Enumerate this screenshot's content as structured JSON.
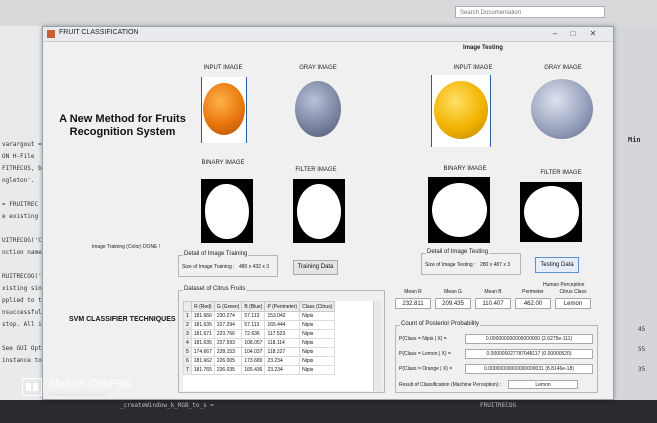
{
  "window": {
    "title": "FRUIT CLASSIFICATION",
    "minimize": "–",
    "maximize": "□",
    "close": "✕"
  },
  "left_panel": {
    "heading_line1": "A New Method for Fruits",
    "heading_line2": "Recognition System",
    "input_image_label": "INPUT IMAGE",
    "gray_image_label": "GRAY IMAGE",
    "binary_image_label": "BINARY IMAGE",
    "filter_image_label": "FILTER IMAGE",
    "training_status": "Image Training (Color) DONE !",
    "training_group": {
      "title": "Detail of Image Training",
      "size_label": "Size of Image Training :",
      "size_value": "480 x 432 x 3",
      "button": "Training Data"
    },
    "svm_label": "SVM CLASSIFIER TECHNIQUES"
  },
  "right_panel": {
    "title": "Image Testing",
    "input_image_label": "INPUT IMAGE",
    "gray_image_label": "GRAY IMAGE",
    "binary_image_label": "BINARY IMAGE",
    "filter_image_label": "FILTER IMAGE",
    "testing_group": {
      "title": "Detail of Image Testing",
      "size_label": "Size of Image Testing :",
      "size_value": "280 x 487 x 3",
      "button": "Testing Data"
    },
    "human_perception": "Human Perception",
    "means": {
      "labels": [
        "Mean R",
        "Mean G",
        "Mean B",
        "Perimeter",
        "Citrus Class"
      ],
      "values": [
        "232.811",
        "209.435",
        "110.407",
        "462.00",
        "Lemon"
      ]
    },
    "probability": {
      "title": "Count of Posterior Probability",
      "rows": [
        {
          "label": "P(Class = Nipis | X) =",
          "value": "0.000000000000000000 (2.6275e-111)"
        },
        {
          "label": "P(Class = Lemon | X) =",
          "value": "0.000000027787048117 (0.00000520)"
        },
        {
          "label": "P(Class = Orange | X) =",
          "value": "0.00000000000000000031 (8.8146e-18)"
        }
      ],
      "result_label": "Result of Classification (Machine Perception) :",
      "result_value": "Lemon"
    }
  },
  "dataset": {
    "title": "Dataset of Citrus Fruits",
    "columns": [
      "",
      "R (Red)",
      "G (Green)",
      "B (Blue)",
      "P (Perimeter)",
      "Class (Citrus)"
    ],
    "rows": [
      [
        "1",
        "181.666",
        "230.274",
        "57.113",
        "153.042",
        "Nipis"
      ],
      [
        "2",
        "181.635",
        "227.294",
        "57.113",
        "165.444",
        "Nipis"
      ],
      [
        "3",
        "181.671",
        "223.766",
        "72.636",
        "117.523",
        "Nipis"
      ],
      [
        "4",
        "181.635",
        "227.593",
        "108.057",
        "118.114",
        "Nipis"
      ],
      [
        "5",
        "174.667",
        "228.153",
        "104.037",
        "118.227",
        "Nipis"
      ],
      [
        "6",
        "181.662",
        "226.005",
        "173.680",
        "23.234",
        "Nipis"
      ],
      [
        "7",
        "181.765",
        "236.035",
        "165.436",
        "23.234",
        "Nipis"
      ]
    ]
  },
  "background": {
    "code_lines": [
      "varargout = ",
      "ON H-File",
      "FITRECOS, b",
      "ngleton'.",
      "",
      "= FRUITREC",
      "e existing",
      "",
      "UITRECOG('C",
      "nction name",
      "",
      "RUITRECOG('",
      "xisting sing",
      "pplied to th",
      "nsuccessful",
      "stop. All in",
      "",
      "See GUI Opti",
      "instance to"
    ],
    "right_labels": [
      "Min",
      "45",
      "55",
      "35"
    ],
    "bottom_code": "_createWindow_k_RGB_to_s =",
    "bottom_right": "FRUITRECOG",
    "search_placeholder": "Search Documentation"
  },
  "watermark": {
    "main": "Shot on OnePlus",
    "sub": "Powered by Dual Camera"
  }
}
